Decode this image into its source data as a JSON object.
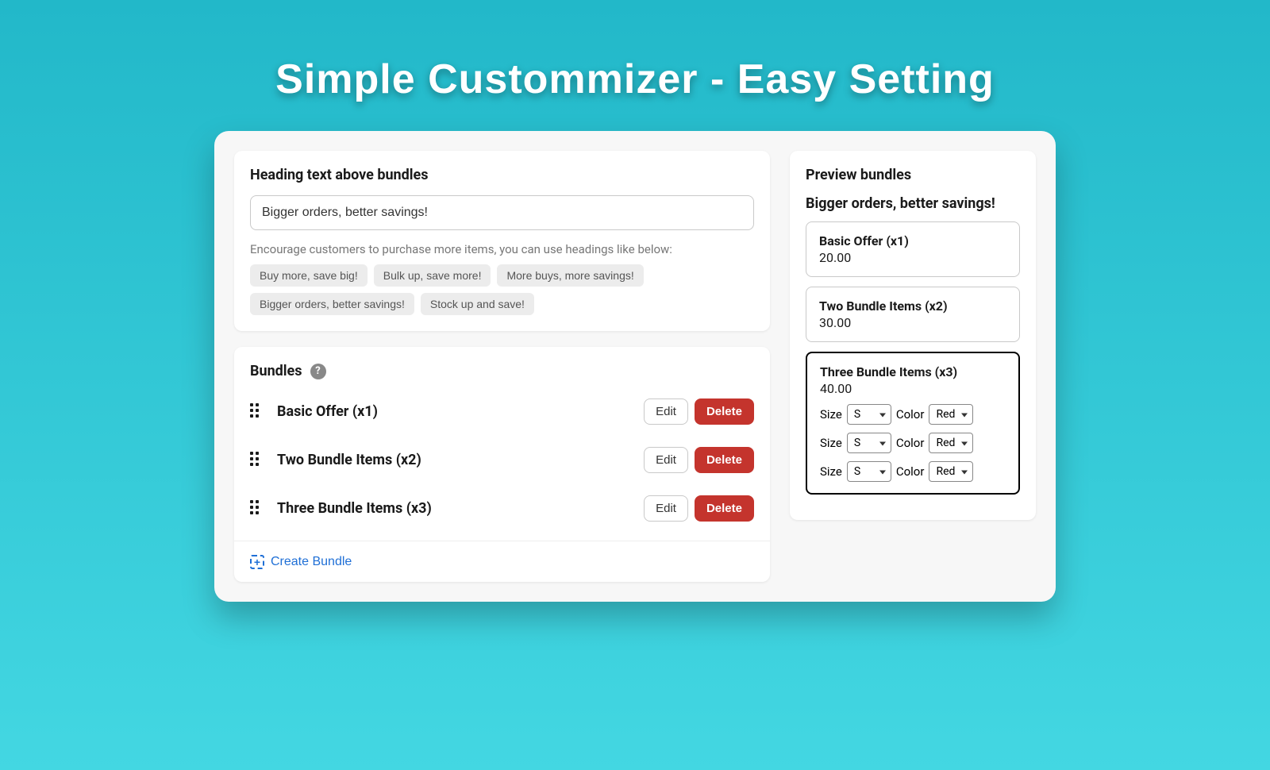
{
  "hero": {
    "title": "Simple Custommizer -  Easy Setting"
  },
  "heading_section": {
    "title": "Heading text above bundles",
    "input_value": "Bigger orders, better savings!",
    "helper": "Encourage customers to purchase more items, you can use headings like below:",
    "suggestions": [
      "Buy more, save big!",
      "Bulk up, save more!",
      "More buys, more savings!",
      "Bigger orders, better savings!",
      "Stock up and save!"
    ]
  },
  "bundles_section": {
    "title": "Bundles",
    "edit_label": "Edit",
    "delete_label": "Delete",
    "create_label": "Create Bundle",
    "items": [
      {
        "name": "Basic Offer (x1)"
      },
      {
        "name": "Two Bundle Items (x2)"
      },
      {
        "name": "Three Bundle Items (x3)"
      }
    ]
  },
  "preview": {
    "title": "Preview bundles",
    "heading": "Bigger orders, better savings!",
    "size_label": "Size",
    "color_label": "Color",
    "cards": [
      {
        "name": "Basic Offer (x1)",
        "price": "20.00",
        "selected": false,
        "option_rows": 0
      },
      {
        "name": "Two Bundle Items (x2)",
        "price": "30.00",
        "selected": false,
        "option_rows": 0
      },
      {
        "name": "Three Bundle Items (x3)",
        "price": "40.00",
        "selected": true,
        "option_rows": 3,
        "size_value": "S",
        "color_value": "Red"
      }
    ]
  }
}
